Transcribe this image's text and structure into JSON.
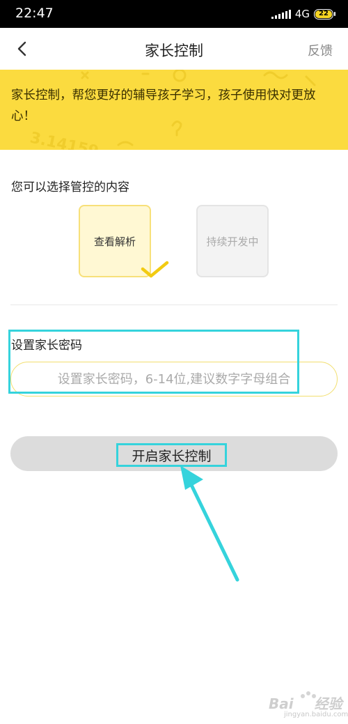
{
  "status_bar": {
    "time": "22:47",
    "network": "4G",
    "battery": "22"
  },
  "nav": {
    "title": "家长控制",
    "feedback": "反馈",
    "back_icon": "chevron-left-icon"
  },
  "banner": {
    "text": "家长控制，帮您更好的辅导孩子学习，孩子使用快对更放心！",
    "decor_text": "3.14159",
    "color": "#fbdb3f"
  },
  "controls": {
    "label": "您可以选择管控的内容",
    "options": [
      {
        "label": "查看解析",
        "selected": true
      },
      {
        "label": "持续开发中",
        "selected": false
      }
    ]
  },
  "password": {
    "label": "设置家长密码",
    "placeholder": "设置家长密码，6-14位,建议数字字母组合"
  },
  "action": {
    "enable_label": "开启家长控制"
  },
  "annotation": {
    "highlight_color": "#35d3dc"
  },
  "watermark": {
    "brand": "Bai",
    "brand_suffix": "经验",
    "url": "jingyan.baidu.com"
  }
}
